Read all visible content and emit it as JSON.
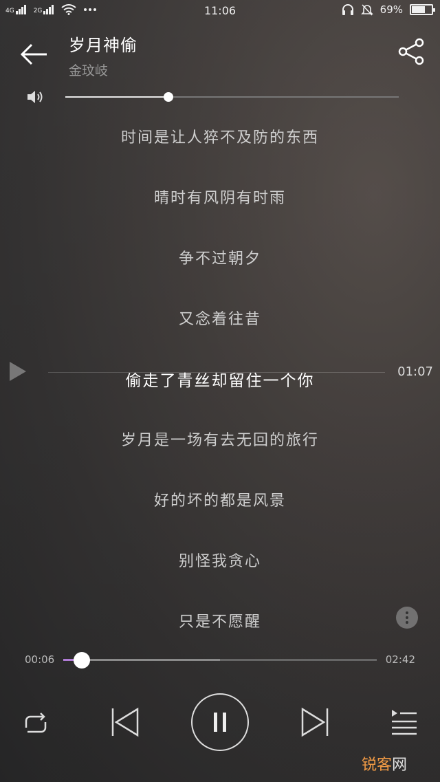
{
  "status_bar": {
    "net1": "4G",
    "net2": "2G",
    "time": "11:06",
    "battery_text": "69%",
    "battery_level": 0.69,
    "icons": [
      "signal-icon",
      "wifi-icon",
      "more-dots-icon",
      "headphone-icon",
      "mute-bell-icon",
      "battery-icon"
    ]
  },
  "header": {
    "title": "岁月神偷",
    "artist": "金玟岐"
  },
  "volume": {
    "level": 0.31
  },
  "lyrics": [
    "时间是让人猝不及防的东西",
    "晴时有风阴有时雨",
    "争不过朝夕",
    "又念着往昔",
    "偷走了青丝却留住一个你",
    "岁月是一场有去无回的旅行",
    "好的坏的都是风景",
    "别怪我贪心",
    "只是不愿醒"
  ],
  "current_lyric_index": 4,
  "lyric_time": "01:07",
  "progress": {
    "current": "00:06",
    "total": "02:42",
    "played_fraction": 0.06,
    "buffered_fraction": 0.5
  },
  "watermark": {
    "part_a": "锐客",
    "part_b": "网"
  },
  "colors": {
    "accent": "#b07cd6",
    "watermark_orange": "#f29b45"
  }
}
